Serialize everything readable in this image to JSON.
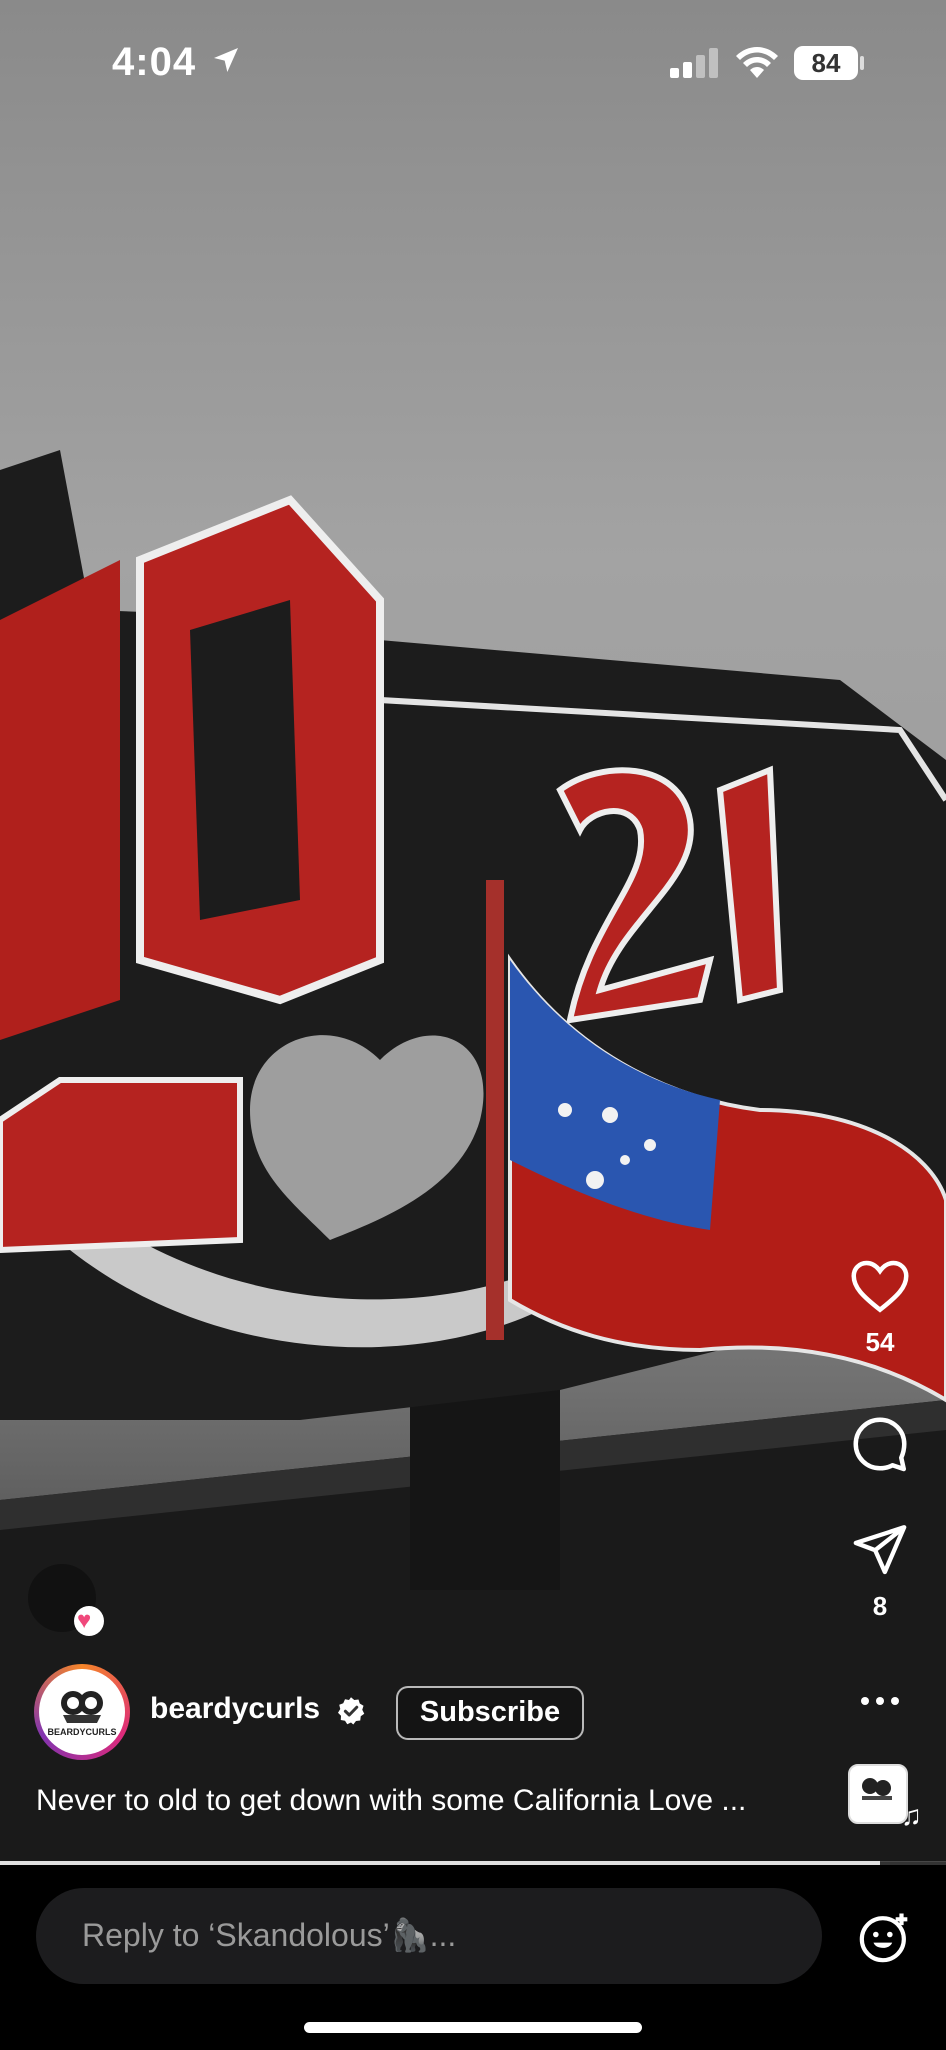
{
  "status_bar": {
    "time": "4:04",
    "battery": "84"
  },
  "actions": {
    "like_count": "54",
    "share_count": "8"
  },
  "author": {
    "username": "beardycurls",
    "avatar_text": "BEARDYCURLS",
    "subscribe_label": "Subscribe"
  },
  "caption": "Never to old to get down with some California Love ...",
  "reply": {
    "placeholder": "Reply to ‘Skandolous’🦍..."
  },
  "progress": {
    "fraction": 0.93
  },
  "icons": {
    "location": "location-arrow-icon",
    "like": "heart-icon",
    "comment": "comment-bubble-icon",
    "share": "paper-plane-icon",
    "more": "more-dots-icon",
    "emoji": "emoji-add-icon"
  }
}
